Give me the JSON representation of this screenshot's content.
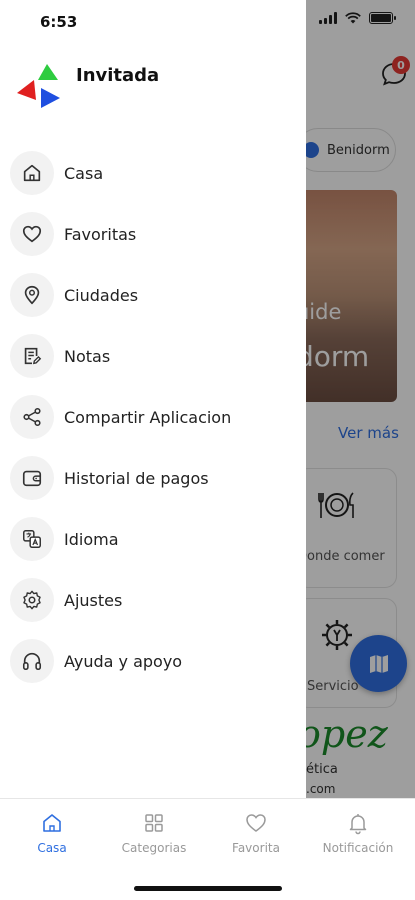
{
  "status": {
    "time": "6:53"
  },
  "drawer": {
    "user_name": "Invitada",
    "menu": [
      {
        "label": "Casa",
        "icon": "home-icon"
      },
      {
        "label": "Favoritas",
        "icon": "heart-icon"
      },
      {
        "label": "Ciudades",
        "icon": "map-pin-icon"
      },
      {
        "label": "Notas",
        "icon": "notes-icon"
      },
      {
        "label": "Compartir Aplicacion",
        "icon": "share-icon"
      },
      {
        "label": "Historial de pagos",
        "icon": "wallet-icon"
      },
      {
        "label": "Idioma",
        "icon": "translate-icon"
      },
      {
        "label": "Ajustes",
        "icon": "settings-icon"
      },
      {
        "label": "Ayuda y apoyo",
        "icon": "headphones-icon"
      }
    ]
  },
  "background": {
    "chat_badge": "0",
    "city_chip": "Benidorm",
    "hero_line1": "uide",
    "hero_line2": "dorm",
    "see_more": "Ver más",
    "card1_label": "Donde comer",
    "card2_label": "Servicio",
    "ad_script": "opez",
    "ad_line1": "ética",
    "ad_line2": ".com"
  },
  "bottom_nav": {
    "items": [
      {
        "label": "Casa",
        "icon": "home-icon",
        "active": true
      },
      {
        "label": "Categorias",
        "icon": "grid-icon",
        "active": false
      },
      {
        "label": "Favorita",
        "icon": "heart-icon",
        "active": false
      },
      {
        "label": "Notificación",
        "icon": "bell-icon",
        "active": false
      }
    ]
  },
  "colors": {
    "accent": "#2f6fe0",
    "badge": "#e53935",
    "dim_overlay": "rgba(0,0,0,0.38)"
  }
}
